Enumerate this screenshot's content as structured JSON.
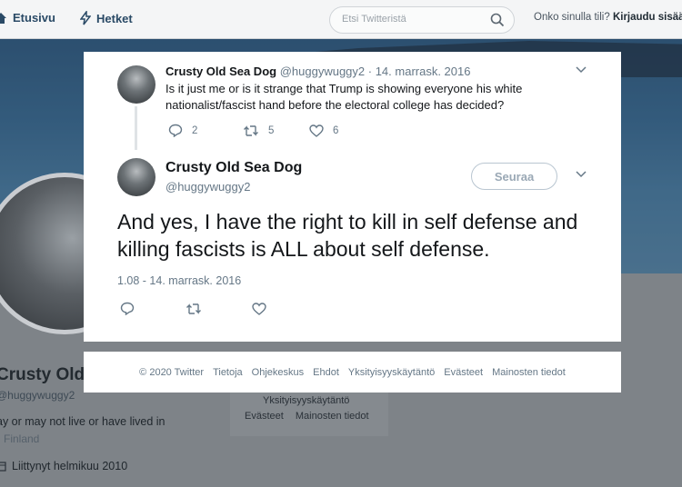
{
  "topbar": {
    "home_label": "Etusivu",
    "moments_label": "Hetket",
    "search_placeholder": "Etsi Twitteristä",
    "login_question": "Onko sinulla tili?",
    "login_link": "Kirjaudu sisään"
  },
  "background_profile": {
    "name": "Crusty Old",
    "handle": "@huggywuggy2",
    "bio": "ay or may not live or have lived in",
    "location": "Finland",
    "joined": "Liittynyt helmikuu 2010",
    "side_box": {
      "line1": "Yksityisyyskäytäntö",
      "line2": [
        "Evästeet",
        "Mainosten tiedot"
      ]
    }
  },
  "tweet1": {
    "author_name": "Crusty Old Sea Dog",
    "handle": "@huggywuggy2",
    "date": "· 14. marrask. 2016",
    "text": "Is it just me or is it strange that Trump is showing everyone his white nationalist/fascist hand before the electoral college has decided?",
    "replies": "2",
    "retweets": "5",
    "likes": "6"
  },
  "tweet2": {
    "author_name": "Crusty Old Sea Dog",
    "handle": "@huggywuggy2",
    "follow_label": "Seuraa",
    "text": "And yes, I have the right to kill in self defense and killing fascists is ALL about self defense.",
    "timestamp": "1.08 - 14. marrask. 2016"
  },
  "footer": {
    "links": [
      "© 2020 Twitter",
      "Tietoja",
      "Ohjekeskus",
      "Ehdot",
      "Yksityisyyskäytäntö",
      "Evästeet",
      "Mainosten tiedot"
    ]
  },
  "icons": {
    "home": "home-icon",
    "moments": "lightning-icon",
    "search": "search-icon",
    "reply": "reply-icon",
    "retweet": "retweet-icon",
    "like": "heart-icon",
    "more": "chevron-down-icon",
    "calendar": "calendar-icon"
  },
  "colors": {
    "link": "#1da1f2",
    "text": "#14171a",
    "muted": "#657786"
  }
}
